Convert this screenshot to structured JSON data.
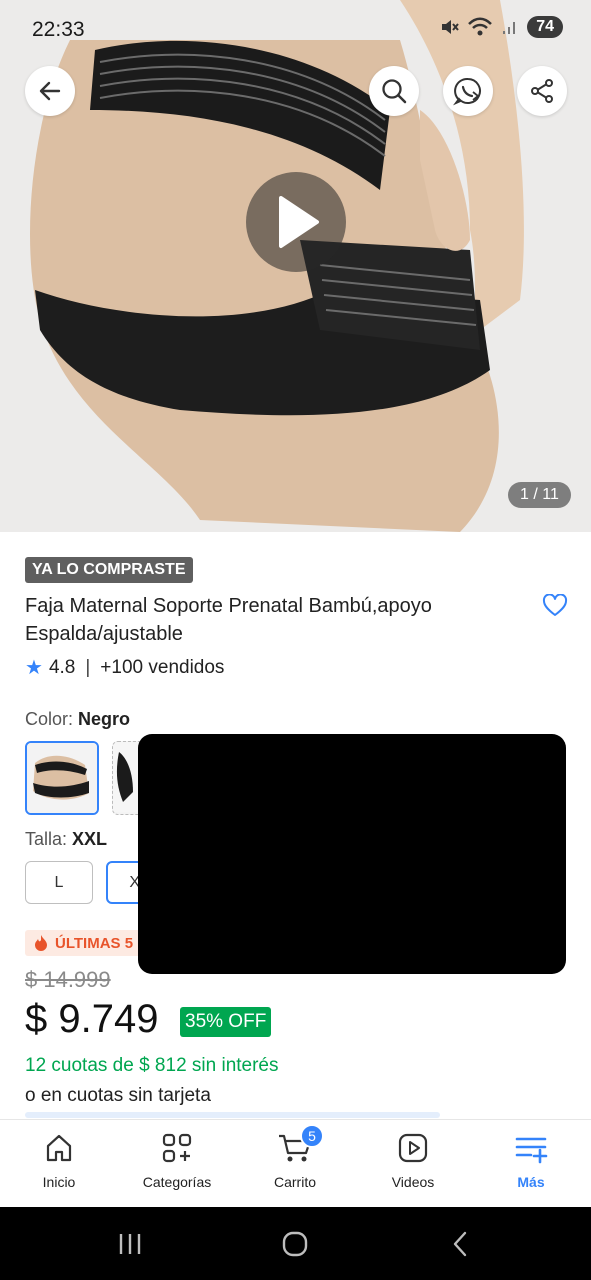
{
  "status_bar": {
    "time": "22:33",
    "battery": "74"
  },
  "gallery": {
    "counter": "1 / 11"
  },
  "product": {
    "badge": "YA LO COMPRASTE",
    "title": "Faja Maternal Soporte Prenatal Bambú,apoyo Espalda/ajustable",
    "rating": "4.8",
    "rating_sep": "|",
    "sold": "+100 vendidos"
  },
  "color": {
    "label": "Color: ",
    "value": "Negro"
  },
  "size": {
    "label": "Talla: ",
    "value": "XXL",
    "options": [
      "L",
      "XX"
    ]
  },
  "stock_tag": "ÚLTIMAS 5",
  "pricing": {
    "old_price": "$ 14.999",
    "price": "$ 9.749",
    "discount": "35% OFF",
    "installments": "12 cuotas de $ 812  sin interés",
    "installments_alt": "o en cuotas sin tarjeta"
  },
  "tabbar": {
    "inicio": "Inicio",
    "categorias": "Categorías",
    "carrito": "Carrito",
    "carrito_count": "5",
    "videos": "Videos",
    "mas": "Más"
  },
  "colors": {
    "accent": "#3483fa",
    "green": "#00a650",
    "orange": "#e8542b"
  }
}
